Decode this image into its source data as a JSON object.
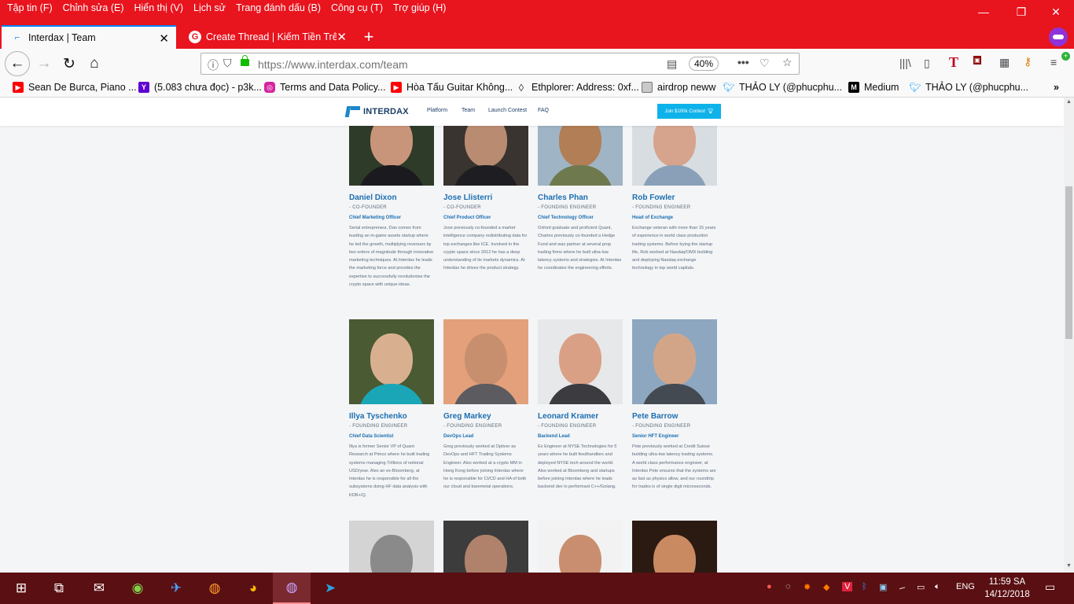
{
  "browser": {
    "menus": [
      "Tập tin (F)",
      "Chỉnh sửa (E)",
      "Hiển thị (V)",
      "Lịch sử",
      "Trang đánh dấu (B)",
      "Công cụ (T)",
      "Trợ giúp (H)"
    ],
    "tabs": [
      {
        "title": "Interdax | Team"
      },
      {
        "title": "Create Thread | Kiếm Tiền Trên"
      }
    ],
    "url": {
      "host": "https://www.interdax.com",
      "path": "/team"
    },
    "zoom": "40%",
    "bookmarks": [
      {
        "label": "Sean De Burca, Piano ...",
        "icon": "youtube-icon"
      },
      {
        "label": "(5.083 chưa đọc) - p3k...",
        "icon": "yahoo-icon"
      },
      {
        "label": "Terms and Data Policy...",
        "icon": "instagram-icon"
      },
      {
        "label": "Hòa Tấu Guitar Không...",
        "icon": "youtube-icon"
      },
      {
        "label": "Ethplorer: Address: 0xf...",
        "icon": "ethereum-icon"
      },
      {
        "label": "airdrop neww",
        "icon": "folder-icon"
      },
      {
        "label": "THẢO LY (@phucphu...",
        "icon": "twitter-icon"
      },
      {
        "label": "Medium",
        "icon": "medium-icon"
      },
      {
        "label": "THẢO LY (@phucphu...",
        "icon": "twitter-icon"
      }
    ]
  },
  "site": {
    "logo": "INTERDAX",
    "nav": [
      "Platform",
      "Team",
      "Launch Contest",
      "FAQ"
    ],
    "cta": "Join $100k Contest"
  },
  "team": [
    {
      "name": "Daniel Dixon",
      "role": "- CO-FOUNDER",
      "title": "Chief Marketing Officer",
      "bio": "Serial entrepreneur, Dan comes from leading an in-game assets startup where he led the growth, multiplying revenues by two orders of magnitude through innovative marketing techniques. At Interdax he leads the marketing force and provides the expertise to successfully revolutionise the crypto space with unique ideas."
    },
    {
      "name": "Jose Llisterri",
      "role": "- CO-FOUNDER",
      "title": "Chief Product Officer",
      "bio": "Jose previously co-founded a market intelligence company redistributing data for top exchanges like ICE. Involved in the crypto space since 2012 he has a deep understanding of its markets dynamics. At Interdax he drives the product strategy."
    },
    {
      "name": "Charles Phan",
      "role": "- FOUNDING ENGINEER",
      "title": "Chief Technology Officer",
      "bio": "Oxford graduate and proficient Quant, Charles previously co-founded a Hedge Fund and was partner at several prop trading firms where he built ultra-low latency systems and strategies. At Interdax he coordinates the engineering efforts."
    },
    {
      "name": "Rob Fowler",
      "role": "- FOUNDING ENGINEER",
      "title": "Head of Exchange",
      "bio": "Exchange veteran with more than 15 years of experience in world class production trading systems. Before trying the startup life, Rob worked at Nasdaq/OMX building and deploying Nasdaq exchange technology in top world capitals."
    },
    {
      "name": "Illya Tyschenko",
      "role": "- FOUNDING ENGINEER",
      "title": "Chief Data Scientist",
      "bio": "Illya is former Senior VP of Quant Research at Pimco where he built trading systems managing Trillions of notional USD/year. Also an ex-Bloomberg, at Interdax he is responsible for all the subsystems doing HF data analysis with KDB+/Q."
    },
    {
      "name": "Greg Markey",
      "role": "- FOUNDING ENGINEER",
      "title": "DevOps Lead",
      "bio": "Greg previously worked at Optiver as DevOps and HFT Trading Systems Engineer. Also worked at a crypto MM in Hong Kong before joining Interdax where he is responsible for CI/CD and HA of both our cloud and baremetal operations."
    },
    {
      "name": "Leonard Kramer",
      "role": "- FOUNDING ENGINEER",
      "title": "Backend Lead",
      "bio": "Ex Engineer at NYSE Technologies for 5 years where he built feedhandlers and deployed NYSE tech around the world. Also worked at Bloomberg and startups before joining Interdax where he leads backend dev in performant C++/Golang."
    },
    {
      "name": "Pete Barrow",
      "role": "- FOUNDING ENGINEER",
      "title": "Senior HFT Engineer",
      "bio": "Pete previously worked at Credit Suisse building ultra-low latency trading systems. A world class performance engineer, at Interdax Pete ensures that the systems are as fast as physics allow, and our roundtrip for trades is of single digit microseconds."
    }
  ],
  "taskbar": {
    "language": "ENG",
    "time": "11:59 SA",
    "date": "14/12/2018"
  },
  "colors": {
    "chrome_red": "#e8141e",
    "brand_blue": "#1c6fb0",
    "cta_blue": "#0eb2ea",
    "taskbar": "#5a0f12"
  }
}
